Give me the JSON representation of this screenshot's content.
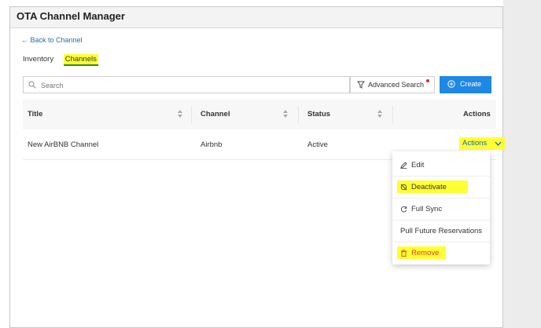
{
  "header": {
    "title": "OTA Channel Manager"
  },
  "back_link": {
    "label": "← Back to Channel"
  },
  "tabs": [
    {
      "label": "Inventory",
      "active": false
    },
    {
      "label": "Channels",
      "active": true
    }
  ],
  "toolbar": {
    "search_placeholder": "Search",
    "advanced_search_label": "Advanced Search",
    "create_label": "Create"
  },
  "table": {
    "columns": [
      "Title",
      "Channel",
      "Status",
      "Actions"
    ],
    "rows": [
      {
        "title": "New AirBNB Channel",
        "channel": "Airbnb",
        "status": "Active",
        "actions_label": "Actions"
      }
    ]
  },
  "actions_menu": {
    "items": [
      {
        "label": "Edit",
        "icon": "pencil-icon"
      },
      {
        "label": "Deactivate",
        "icon": "deactivate-icon"
      },
      {
        "label": "Full Sync",
        "icon": "sync-icon"
      },
      {
        "label": "Pull Future Reservations"
      },
      {
        "label": "Remove",
        "icon": "trash-icon"
      }
    ]
  },
  "colors": {
    "accent": "#1e88e5",
    "highlight": "#ffff33",
    "danger": "#e53935",
    "link": "#2b6cb0"
  }
}
